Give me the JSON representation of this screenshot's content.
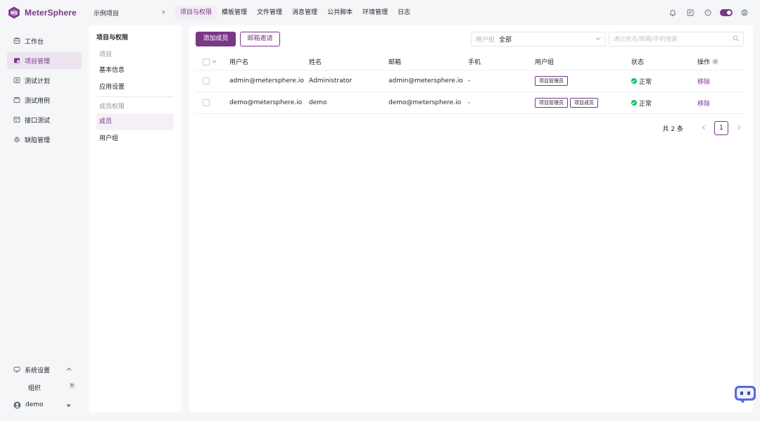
{
  "app": {
    "name": "MeterSphere"
  },
  "header": {
    "project": "示例项目",
    "nav": [
      "项目与权限",
      "模板管理",
      "文件管理",
      "消息管理",
      "公共脚本",
      "环境管理",
      "日志"
    ],
    "active_nav": 0
  },
  "sidebar": {
    "items": [
      {
        "label": "工作台",
        "icon": "workbench-icon"
      },
      {
        "label": "项目管理",
        "icon": "project-icon"
      },
      {
        "label": "测试计划",
        "icon": "test-plan-icon"
      },
      {
        "label": "测试用例",
        "icon": "test-case-icon"
      },
      {
        "label": "接口测试",
        "icon": "api-test-icon"
      },
      {
        "label": "缺陷管理",
        "icon": "bug-icon"
      }
    ],
    "active": 1,
    "system": "系统设置",
    "org": "组织",
    "org_badge": "默",
    "user": "demo"
  },
  "submenu": {
    "title": "项目与权限",
    "group_project": "项目",
    "basic_info": "基本信息",
    "app_settings": "应用设置",
    "group_members": "成员权限",
    "members": "成员",
    "user_groups": "用户组"
  },
  "toolbar": {
    "add_member": "添加成员",
    "email_invite": "邮箱邀请",
    "group_prefix": "用户组",
    "group_value": "全部",
    "search_placeholder": "通过姓名/邮箱/手机搜索"
  },
  "table": {
    "headers": {
      "username": "用户名",
      "name": "姓名",
      "email": "邮箱",
      "phone": "手机",
      "group": "用户组",
      "status": "状态",
      "op": "操作"
    },
    "rows": [
      {
        "username": "admin@metersphere.io",
        "name": "Administrator",
        "email": "admin@metersphere.io",
        "phone": "-",
        "groups": [
          "项目管理员"
        ],
        "status": "正常",
        "op": "移除"
      },
      {
        "username": "demo@metersphere.io",
        "name": "demo",
        "email": "demo@metersphere.io",
        "phone": "-",
        "groups": [
          "项目管理员",
          "项目成员"
        ],
        "status": "正常",
        "op": "移除"
      }
    ]
  },
  "pagination": {
    "total": "共 2 条",
    "current": "1"
  },
  "colors": {
    "brand": "#783887",
    "success": "#00c261"
  }
}
